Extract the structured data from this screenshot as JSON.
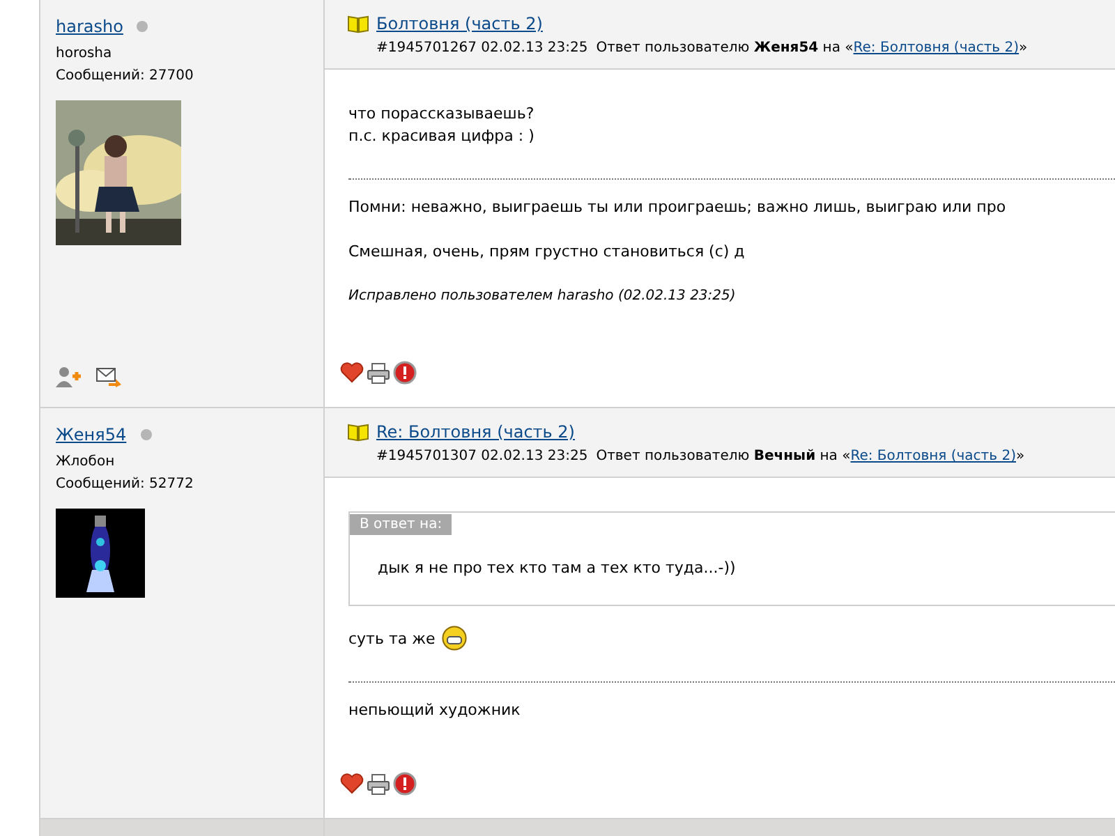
{
  "posts": [
    {
      "author": {
        "name": "harasho",
        "online": false,
        "title": "horosha",
        "count": "Сообщений: 27700"
      },
      "topic": "Болтовня (часть 2)",
      "meta": "#1945701267 02.02.13 23:25",
      "reply_text": "Ответ пользователю **Женя54** на «",
      "reply_link": "Re: Болтовня (часть 2)",
      "reply_close": "»",
      "body": [
        "что порассказываешь?",
        "п.с. красивая цифра : )"
      ],
      "signature": [
        "Помни: неважно, выиграешь ты или проиграешь; важно лишь, выиграю или про",
        "Смешная, очень, прям грустно становиться (с) д"
      ],
      "edited": "Исправлено пользователем harasho (02.02.13 23:25)",
      "profile_icons": true
    },
    {
      "author": {
        "name": "Женя54",
        "online": false,
        "title": "Жлобон",
        "count": "Сообщений: 52772"
      },
      "topic": "Re: Болтовня (часть 2)",
      "meta": "#1945701307 02.02.13 23:25",
      "reply_text": "Ответ пользователю **Вечный** на «",
      "reply_link": "Re: Болтовня (часть 2)",
      "reply_close": "»",
      "quote": {
        "label": "В ответ на:",
        "text": "дык я не про тех кто там а тех кто туда...-))"
      },
      "body": [
        "суть та же"
      ],
      "smiley": true,
      "signature": [
        "непьющий художник"
      ]
    }
  ]
}
